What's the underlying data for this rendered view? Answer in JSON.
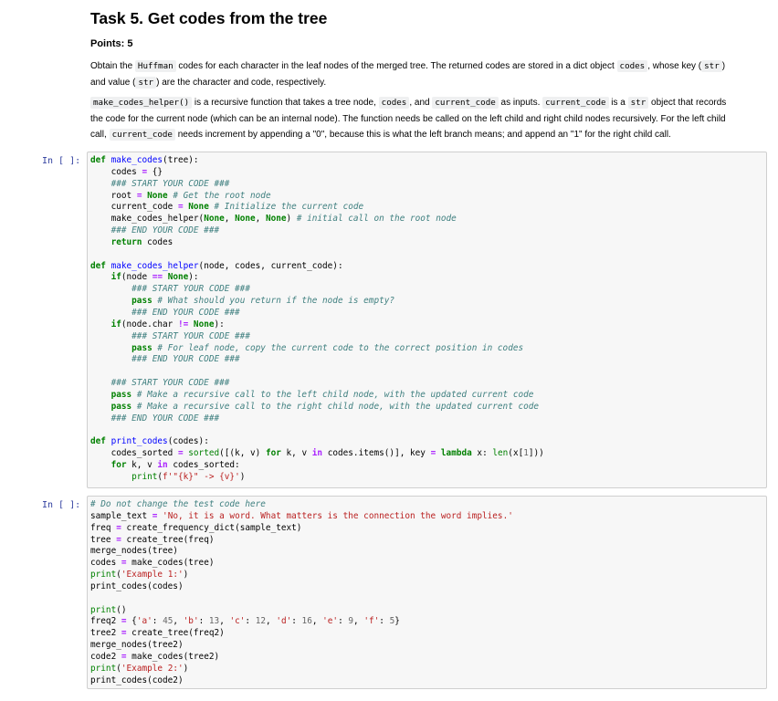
{
  "task": {
    "title": "Task 5. Get codes from the tree",
    "points": "Points: 5"
  },
  "para1": {
    "t1": "Obtain the ",
    "c1": "Huffman",
    "t2": " codes for each character in the leaf nodes of the merged tree. The returned codes are stored in a dict object ",
    "c2": "codes",
    "t3": ", whose key (",
    "c3": "str",
    "t4": ")",
    "line2_t1": "and value (",
    "line2_c1": "str",
    "line2_t2": ") are the character and code, respectively."
  },
  "para2": {
    "c1": "make_codes_helper()",
    "t1": " is a recursive function that takes a tree node, ",
    "c2": "codes",
    "t2": ", and ",
    "c3": "current_code",
    "t3": " as inputs. ",
    "c4": "current_code",
    "t4": " is a ",
    "c5": "str",
    "t5": " object that records",
    "line2": "the code for the current node (which can be an internal node). The function needs be called on the left child and right child nodes recursively. For the left child",
    "line3_t1": "call, ",
    "line3_c1": "current_code",
    "line3_t2": " needs increment by appending a \"0\", because this is what the left branch means; and append an \"1\" for the right child call."
  },
  "prompts": {
    "cell1": "In [ ]:",
    "cell2": "In [ ]:"
  }
}
